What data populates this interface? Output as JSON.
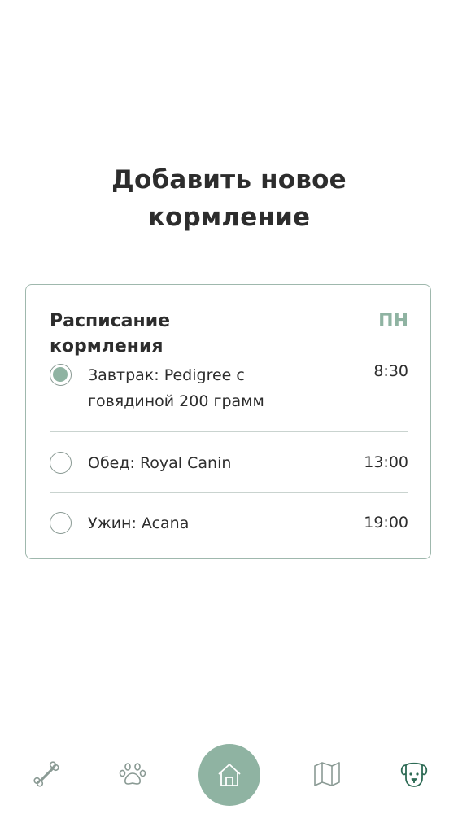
{
  "header": {
    "title_line1": "Добавить новое",
    "title_line2": "кормление"
  },
  "schedule": {
    "title_line1": "Расписание",
    "title_line2": "кормления",
    "day": "ПН",
    "items": [
      {
        "label_line1": "Завтрак: Pedigree с",
        "label_line2": "говядиной 200 грамм",
        "time": "8:30",
        "selected": true
      },
      {
        "label_line1": "Обед: Royal Canin",
        "label_line2": "",
        "time": "13:00",
        "selected": false
      },
      {
        "label_line1": "Ужин: Acana",
        "label_line2": "",
        "time": "19:00",
        "selected": false
      }
    ]
  },
  "tabbar": {
    "tabs": [
      {
        "icon": "bone-icon"
      },
      {
        "icon": "paw-icon"
      },
      {
        "icon": "home-icon",
        "active": true
      },
      {
        "icon": "map-icon"
      },
      {
        "icon": "dog-icon"
      }
    ]
  },
  "colors": {
    "accent": "#8fb3a2",
    "text": "#2d2d2d",
    "icon": "#8a9a94",
    "dog_icon": "#2e6b55"
  }
}
